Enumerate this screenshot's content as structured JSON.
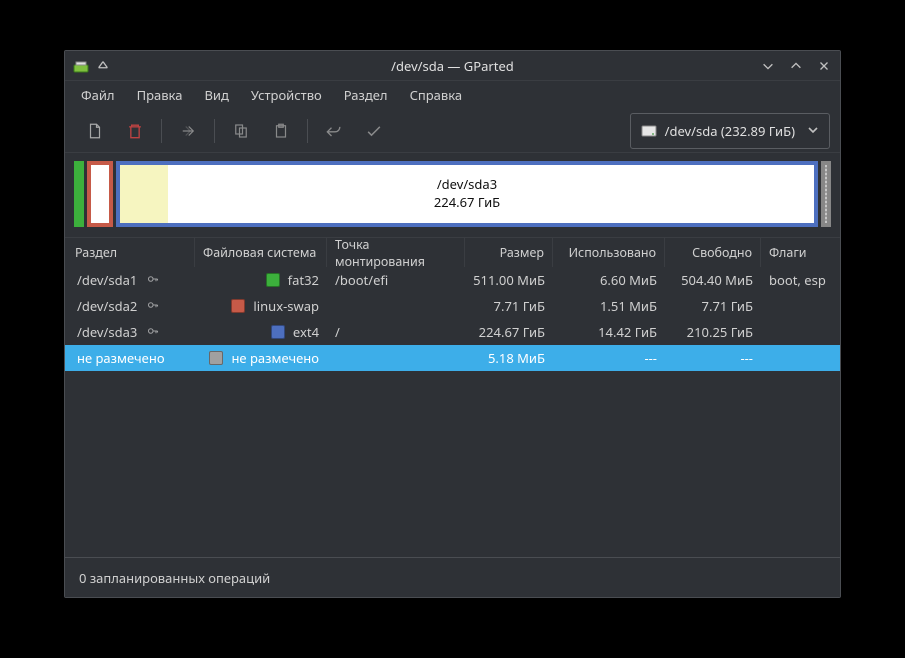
{
  "titlebar": {
    "title": "/dev/sda — GParted"
  },
  "menu": {
    "items": [
      "Файл",
      "Правка",
      "Вид",
      "Устройство",
      "Раздел",
      "Справка"
    ]
  },
  "device_picker": {
    "label": "/dev/sda  (232.89 ГиБ)"
  },
  "graphic": {
    "main_label": "/dev/sda3",
    "main_size": "224.67 ГиБ"
  },
  "columns": {
    "partition": "Раздел",
    "filesystem": "Файловая система",
    "mountpoint": "Точка монтирования",
    "size": "Размер",
    "used": "Использовано",
    "free": "Свободно",
    "flags": "Флаги"
  },
  "rows": [
    {
      "partition": "/dev/sda1",
      "has_key": true,
      "fs": "fat32",
      "fs_swatch": "sw-fat32",
      "mount": "/boot/efi",
      "size": "511.00 МиБ",
      "used": "6.60 МиБ",
      "free": "504.40 МиБ",
      "flags": "boot, esp",
      "selected": false
    },
    {
      "partition": "/dev/sda2",
      "has_key": true,
      "fs": "linux-swap",
      "fs_swatch": "sw-swap",
      "mount": "",
      "size": "7.71 ГиБ",
      "used": "1.51 МиБ",
      "free": "7.71 ГиБ",
      "flags": "",
      "selected": false
    },
    {
      "partition": "/dev/sda3",
      "has_key": true,
      "fs": "ext4",
      "fs_swatch": "sw-ext4",
      "mount": "/",
      "size": "224.67 ГиБ",
      "used": "14.42 ГиБ",
      "free": "210.25 ГиБ",
      "flags": "",
      "selected": false
    },
    {
      "partition": "не размечено",
      "has_key": false,
      "fs": "не размечено",
      "fs_swatch": "sw-unalloc",
      "mount": "",
      "size": "5.18 МиБ",
      "used": "---",
      "free": "---",
      "flags": "",
      "selected": true
    }
  ],
  "footer": {
    "text": "0 запланированных операций"
  }
}
